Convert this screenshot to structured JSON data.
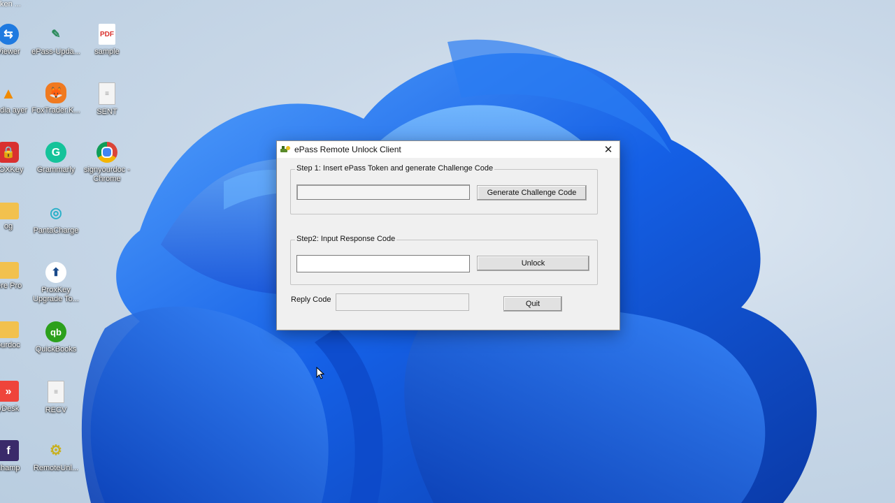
{
  "desktop": {
    "top_fragment": "ken ...",
    "icons": [
      {
        "label": "Viewer",
        "icon": "teamviewer-icon",
        "color": "#1f7ae0"
      },
      {
        "label": "ePass-Upda...",
        "icon": "usb-token-icon",
        "color": "#2a8a5a"
      },
      {
        "label": "sample",
        "icon": "pdf-icon",
        "color": "#d9302c"
      },
      {
        "label": "media ayer",
        "icon": "vlc-icon",
        "color": "#f08a00"
      },
      {
        "label": "FoxTrader.K...",
        "icon": "fox-icon",
        "color": "#f07a20"
      },
      {
        "label": "SENT",
        "icon": "text-file-icon",
        "color": "#f4f4f4"
      },
      {
        "label": "ROXKey",
        "icon": "lock-icon",
        "color": "#d93030"
      },
      {
        "label": "Grammarly",
        "icon": "grammarly-icon",
        "color": "#15c39a"
      },
      {
        "label": "signyourdoc - Chrome",
        "icon": "chrome-icon",
        "color": "#4285f4"
      },
      {
        "label": "og",
        "icon": "folder-icon",
        "color": "#f2c14e"
      },
      {
        "label": "PantaCharge",
        "icon": "pantacharge-icon",
        "color": "#2ab0c8"
      },
      {
        "label": "iere Pro",
        "icon": "folder-icon",
        "color": "#f2c14e"
      },
      {
        "label": "ProxKey Upgrade To...",
        "icon": "proxkey-upgrade-icon",
        "color": "#1a4a8a"
      },
      {
        "label": "ourdoc",
        "icon": "folder-icon",
        "color": "#f2c14e"
      },
      {
        "label": "QuickBooks",
        "icon": "quickbooks-icon",
        "color": "#2ca01c"
      },
      {
        "label": "yDesk",
        "icon": "anydesk-icon",
        "color": "#ef443b"
      },
      {
        "label": "RECV",
        "icon": "text-file-icon",
        "color": "#f4f4f4"
      },
      {
        "label": "champ",
        "icon": "app-icon",
        "color": "#3a2a6a"
      },
      {
        "label": "RemoteUnl...",
        "icon": "remote-unlock-icon",
        "color": "#c8b020"
      }
    ]
  },
  "dialog": {
    "title": "ePass Remote Unlock Client",
    "close_glyph": "✕",
    "step1": {
      "label": "Step 1: Insert ePass Token and generate Challenge Code",
      "challenge_value": "",
      "button": "Generate Challenge Code"
    },
    "step2": {
      "label": "Step2:  Input Response Code",
      "response_value": "",
      "button": "Unlock"
    },
    "reply": {
      "label": "Reply Code",
      "value": ""
    },
    "quit_button": "Quit"
  },
  "colors": {
    "wallpaper_blue": "#1a5fe0",
    "dialog_bg": "#f0f0f0"
  }
}
